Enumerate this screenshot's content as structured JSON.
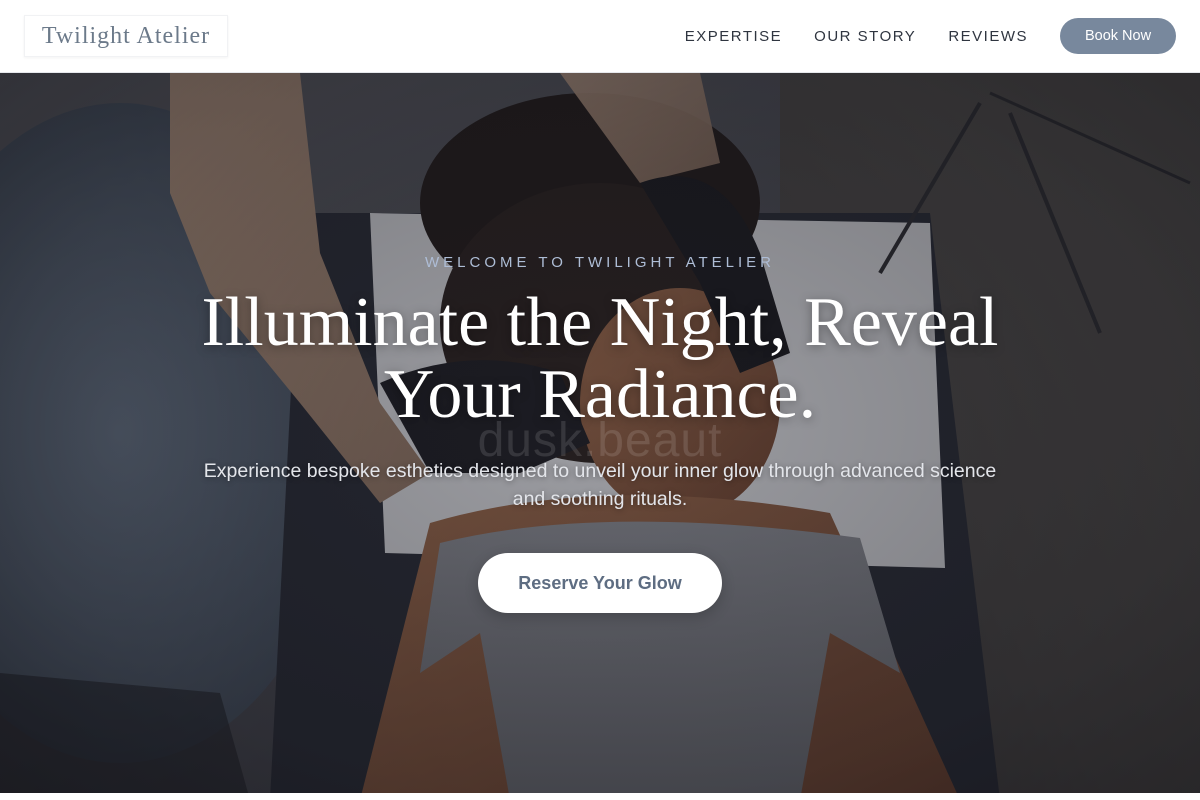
{
  "brand": {
    "name": "Twilight Atelier"
  },
  "nav": {
    "items": [
      {
        "label": "EXPERTISE"
      },
      {
        "label": "OUR STORY"
      },
      {
        "label": "REVIEWS"
      }
    ],
    "book_label": "Book Now"
  },
  "hero": {
    "eyebrow": "WELCOME TO TWILIGHT ATELIER",
    "headline_line1": "Illuminate the Night, Reveal",
    "headline_line2": "Your Radiance.",
    "watermark": "dusk.beaut",
    "subhead": "Experience bespoke esthetics designed to unveil your inner glow through advanced science and soothing rituals.",
    "cta_label": "Reserve Your Glow"
  },
  "colors": {
    "accent": "#78889d",
    "logo_text": "#6c7a8a",
    "eyebrow": "#aebdd6",
    "cta_text": "#5e6d82"
  }
}
